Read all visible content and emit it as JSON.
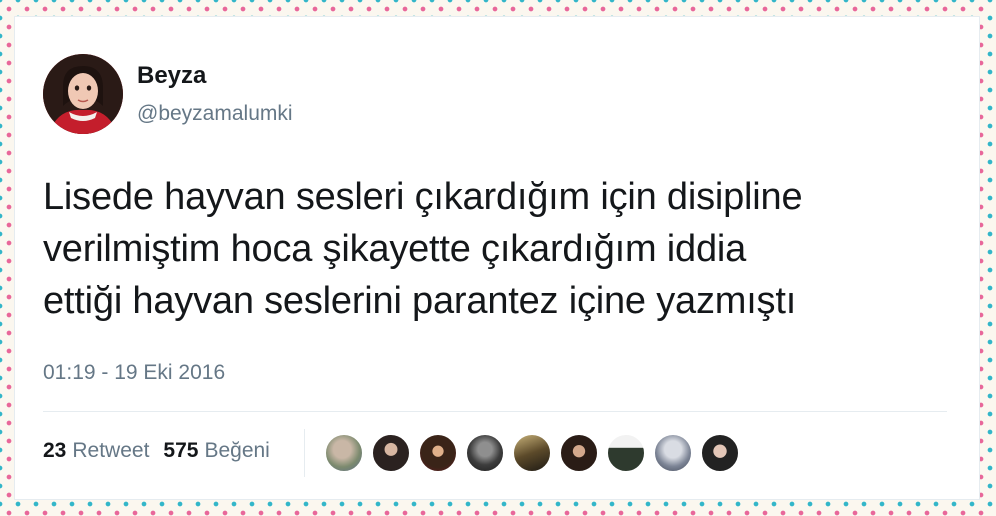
{
  "tweet": {
    "display_name": "Beyza",
    "handle": "@beyzamalumki",
    "lines": [
      "Lisede hayvan sesleri çıkardığım için disipline",
      "verilmiştim hoca şikayette çıkardığım iddia",
      "ettiği hayvan seslerini parantez içine yazmıştı"
    ],
    "timestamp": "01:19 - 19 Eki 2016"
  },
  "stats": {
    "retweet_count": "23",
    "retweet_label": "Retweet",
    "like_count": "575",
    "like_label": "Beğeni"
  },
  "colors": {
    "text": "#14171a",
    "secondary": "#657786",
    "divider": "#e6ecf0",
    "dot_pink": "#e8679a",
    "dot_teal": "#33b6c9"
  }
}
